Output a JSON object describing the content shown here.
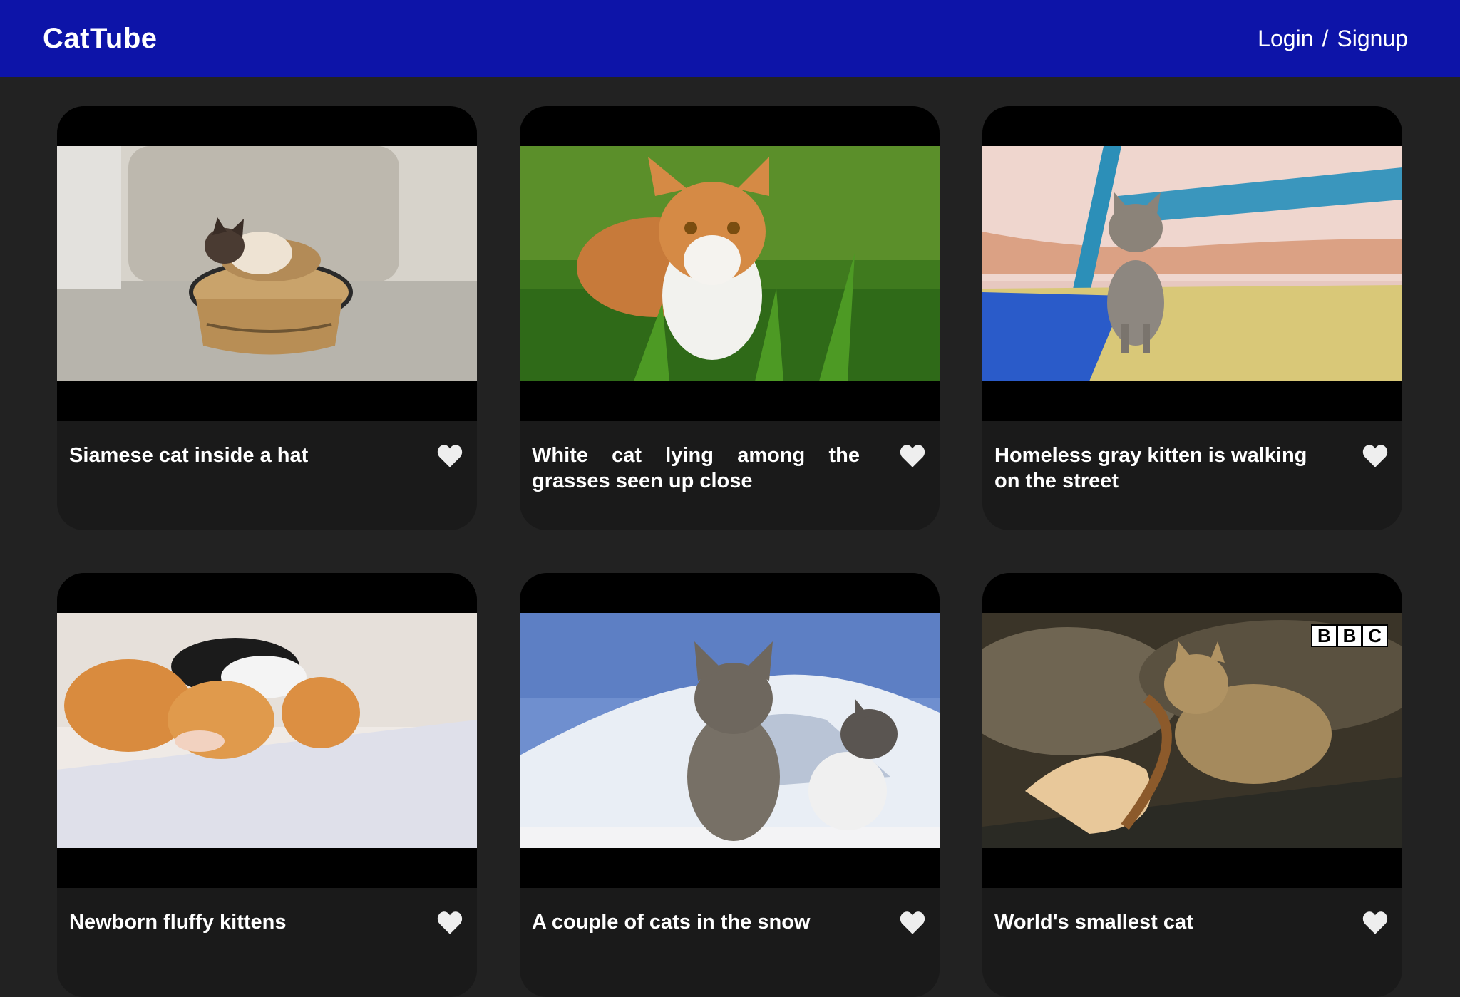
{
  "nav": {
    "brand": "CatTube",
    "login": "Login",
    "separator": "/",
    "signup": "Signup"
  },
  "videos": [
    {
      "title": "Siamese cat inside a hat",
      "thumbnail": "siamese-cat-in-straw-hat"
    },
    {
      "title": "White cat lying among the grasses seen up close",
      "thumbnail": "orange-white-cat-in-grass"
    },
    {
      "title": "Homeless gray kitten is walking on the street",
      "thumbnail": "gray-kitten-on-blue-bench"
    },
    {
      "title": "Newborn fluffy kittens",
      "thumbnail": "newborn-kittens-sleeping"
    },
    {
      "title": "A couple of cats in the snow",
      "thumbnail": "two-cats-in-snow"
    },
    {
      "title": "World's smallest cat",
      "thumbnail": "rusty-spotted-cat-with-leaf",
      "watermark": "BBC"
    }
  ],
  "colors": {
    "navbar": "#0d14a8",
    "page_background": "#222222",
    "card_background": "#1a1a1a",
    "heart": "#eeeeee"
  }
}
